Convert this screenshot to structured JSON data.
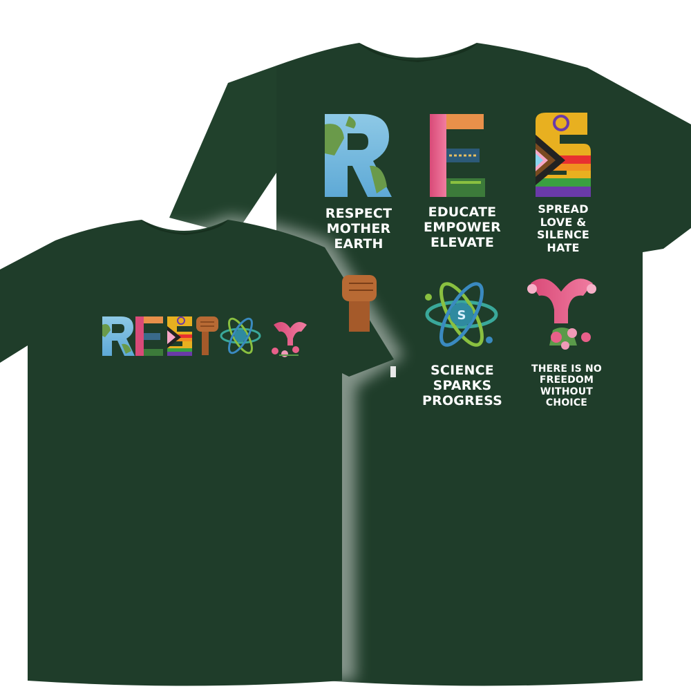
{
  "colors": {
    "shirt": "#1f3d2a",
    "shirt_shadow": "#17301f",
    "background": "#ffffff",
    "caption_text": "#ffffff"
  },
  "front_wordmark_icons": [
    "earth-letter-r",
    "books-letter-e",
    "pride-flag-letter-s",
    "raised-fist-icon",
    "atom-icon",
    "uterus-flowers-icon"
  ],
  "back_design": {
    "panels": [
      {
        "id": "respect-mother-earth",
        "icon": "earth-letter-r",
        "lines": [
          "RESPECT",
          "MOTHER",
          "EARTH"
        ]
      },
      {
        "id": "educate-empower-elevate",
        "icon": "books-letter-e",
        "lines": [
          "EDUCATE",
          "EMPOWER",
          "ELEVATE"
        ]
      },
      {
        "id": "spread-love",
        "icon": "pride-flag-letter-s",
        "lines": [
          "SPREAD",
          "LOVE &",
          "SILENCE",
          "HATE"
        ]
      },
      {
        "id": "science-sparks-progress",
        "icon": "atom-icon",
        "lines": [
          "SCIENCE",
          "SPARKS",
          "PROGRESS"
        ]
      },
      {
        "id": "freedom-choice",
        "icon": "uterus-flowers-icon",
        "lines": [
          "THERE IS NO",
          "FREEDOM",
          "WITHOUT",
          "CHOICE"
        ]
      }
    ]
  }
}
